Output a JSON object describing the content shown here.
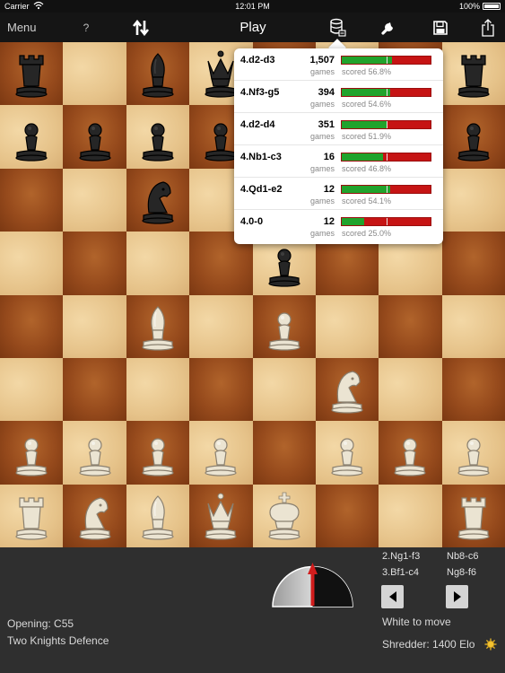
{
  "statusbar": {
    "carrier": "Carrier",
    "time": "12:01 PM",
    "battery": "100%"
  },
  "toolbar": {
    "menu_label": "Menu",
    "help_label": "?",
    "title": "Play",
    "icons": [
      "flip-board-icon",
      "database-icon",
      "wrench-icon",
      "save-icon",
      "share-icon"
    ]
  },
  "board": {
    "light_color": "#e6c38a",
    "dark_color": "#964a1c",
    "pieces": [
      {
        "square": "a8",
        "type": "rook",
        "color": "black"
      },
      {
        "square": "c8",
        "type": "bishop",
        "color": "black"
      },
      {
        "square": "d8",
        "type": "queen",
        "color": "black"
      },
      {
        "square": "h8",
        "type": "rook",
        "color": "black"
      },
      {
        "square": "a7",
        "type": "pawn",
        "color": "black"
      },
      {
        "square": "b7",
        "type": "pawn",
        "color": "black"
      },
      {
        "square": "c7",
        "type": "pawn",
        "color": "black"
      },
      {
        "square": "d7",
        "type": "pawn",
        "color": "black"
      },
      {
        "square": "h7",
        "type": "pawn",
        "color": "black"
      },
      {
        "square": "c6",
        "type": "knight",
        "color": "black"
      },
      {
        "square": "e5",
        "type": "pawn",
        "color": "black"
      },
      {
        "square": "c4",
        "type": "bishop",
        "color": "white"
      },
      {
        "square": "e4",
        "type": "pawn",
        "color": "white"
      },
      {
        "square": "f3",
        "type": "knight",
        "color": "white"
      },
      {
        "square": "a2",
        "type": "pawn",
        "color": "white"
      },
      {
        "square": "b2",
        "type": "pawn",
        "color": "white"
      },
      {
        "square": "c2",
        "type": "pawn",
        "color": "white"
      },
      {
        "square": "d2",
        "type": "pawn",
        "color": "white"
      },
      {
        "square": "f2",
        "type": "pawn",
        "color": "white"
      },
      {
        "square": "g2",
        "type": "pawn",
        "color": "white"
      },
      {
        "square": "h2",
        "type": "pawn",
        "color": "white"
      },
      {
        "square": "a1",
        "type": "rook",
        "color": "white"
      },
      {
        "square": "b1",
        "type": "knight",
        "color": "white"
      },
      {
        "square": "c1",
        "type": "bishop",
        "color": "white"
      },
      {
        "square": "d1",
        "type": "queen",
        "color": "white"
      },
      {
        "square": "e1",
        "type": "king",
        "color": "white"
      },
      {
        "square": "h1",
        "type": "rook",
        "color": "white"
      }
    ]
  },
  "book_moves": [
    {
      "move": "4.d2-d3",
      "count": "1,507",
      "games_label": "games",
      "score_label": "scored 56.8%",
      "score": 0.568
    },
    {
      "move": "4.Nf3-g5",
      "count": "394",
      "games_label": "games",
      "score_label": "scored 54.6%",
      "score": 0.546
    },
    {
      "move": "4.d2-d4",
      "count": "351",
      "games_label": "games",
      "score_label": "scored 51.9%",
      "score": 0.519
    },
    {
      "move": "4.Nb1-c3",
      "count": "16",
      "games_label": "games",
      "score_label": "scored 46.8%",
      "score": 0.468
    },
    {
      "move": "4.Qd1-e2",
      "count": "12",
      "games_label": "games",
      "score_label": "scored 54.1%",
      "score": 0.541
    },
    {
      "move": "4.0-0",
      "count": "12",
      "games_label": "games",
      "score_label": "scored 25.0%",
      "score": 0.25
    }
  ],
  "score_colors": {
    "win": "#21a32c",
    "loss": "#c61414"
  },
  "bottom": {
    "moves": [
      {
        "white": "2.Ng1-f3",
        "black": "Nb8-c6"
      },
      {
        "white": "3.Bf1-c4",
        "black": "Ng8-f6"
      }
    ],
    "status": "White to move",
    "engine": "Shredder: 1400 Elo",
    "opening_code": "Opening: C55",
    "opening_name": "Two Knights Defence"
  }
}
